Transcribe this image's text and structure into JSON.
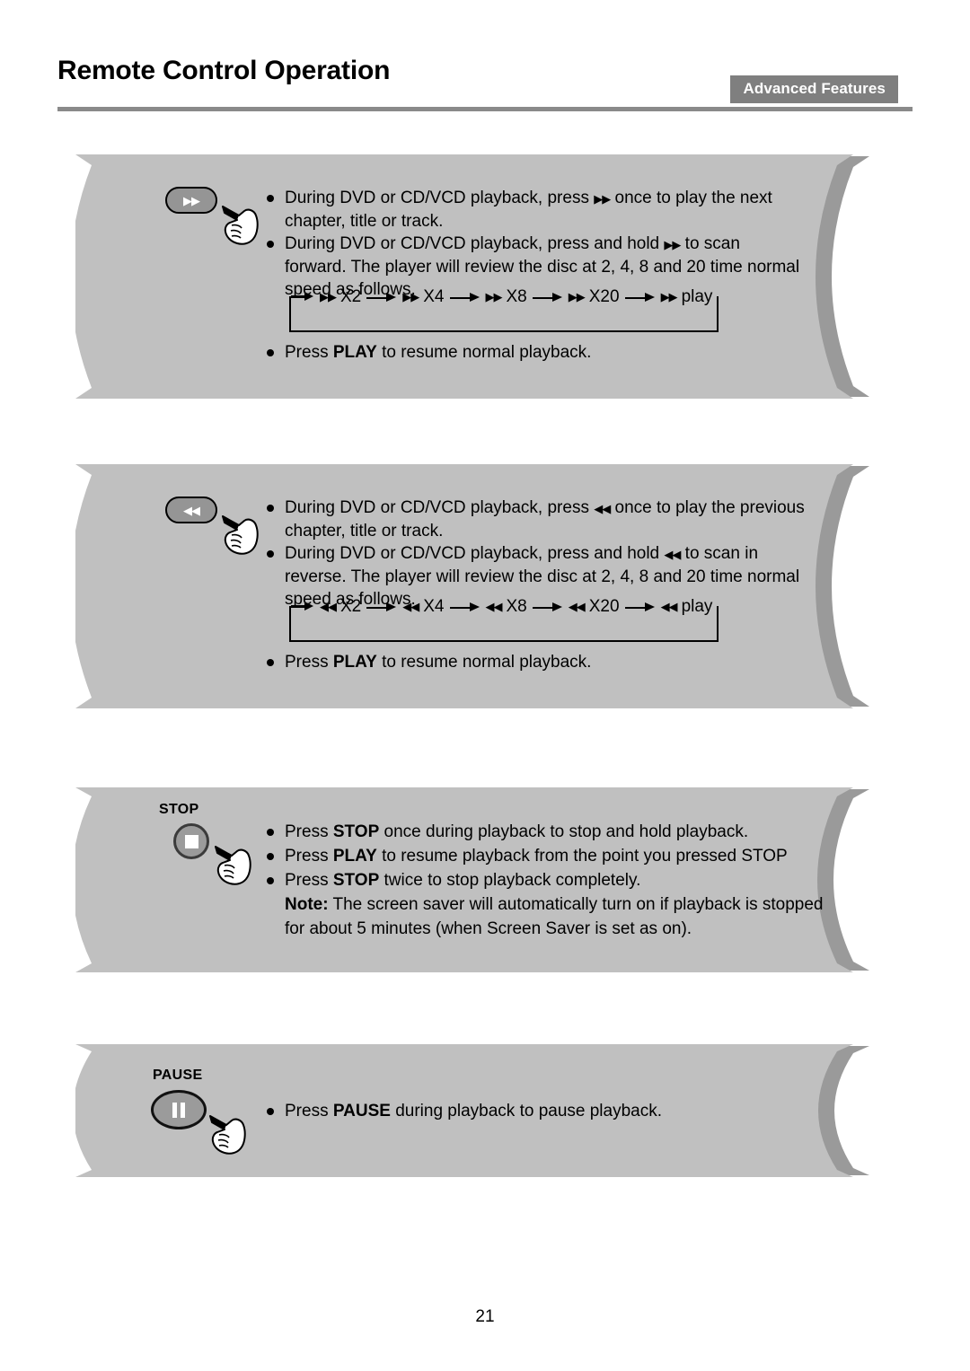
{
  "header": {
    "title": "Remote Control Operation",
    "section_badge": "Advanced Features",
    "badge_color": "#7f7f7f",
    "rule_color": "#8a8a8a"
  },
  "page": {
    "number": "21",
    "background": "#ffffff",
    "banner_fill": "#c0c0c0",
    "banner_shadow": "#9a9a9a"
  },
  "blocks": [
    {
      "id": "fast-forward",
      "button": {
        "icon": "fast-forward-icon",
        "glyph": "▶▶",
        "shape": "pill",
        "caption": ""
      },
      "lines": [
        {
          "bullet": true,
          "parts": [
            {
              "text": "During DVD or CD/VCD playback, press "
            },
            {
              "text": "▶▶",
              "style": "glyph"
            },
            {
              "text": " once to play the next chapter, title or track."
            }
          ]
        },
        {
          "bullet": true,
          "parts": [
            {
              "text": "During DVD or CD/VCD playback, press and hold "
            },
            {
              "text": "▶▶",
              "style": "glyph"
            },
            {
              "text": " to scan forward. The player will review the disc at 2, 4, 8 and 20 time normal speed as follows."
            }
          ]
        }
      ],
      "diagram": {
        "direction_glyph": "▶▶",
        "steps": [
          "X2",
          "X4",
          "X8",
          "X20",
          "play"
        ]
      },
      "footer_lines": [
        {
          "bullet": true,
          "parts": [
            {
              "text": "Press "
            },
            {
              "text": "PLAY",
              "style": "bold"
            },
            {
              "text": " to resume normal playback."
            }
          ]
        }
      ]
    },
    {
      "id": "rewind",
      "button": {
        "icon": "rewind-icon",
        "glyph": "◀◀",
        "shape": "pill",
        "caption": ""
      },
      "lines": [
        {
          "bullet": true,
          "parts": [
            {
              "text": "During DVD or CD/VCD playback, press "
            },
            {
              "text": "◀◀",
              "style": "glyph"
            },
            {
              "text": " once to play the previous chapter, title or track."
            }
          ]
        },
        {
          "bullet": true,
          "parts": [
            {
              "text": "During DVD or CD/VCD playback, press and hold "
            },
            {
              "text": "◀◀",
              "style": "glyph"
            },
            {
              "text": " to scan in reverse. The player will review the disc at 2, 4, 8 and 20 time normal speed as follows."
            }
          ]
        }
      ],
      "diagram": {
        "direction_glyph": "◀◀",
        "steps": [
          "X2",
          "X4",
          "X8",
          "X20",
          "play"
        ]
      },
      "footer_lines": [
        {
          "bullet": true,
          "parts": [
            {
              "text": "Press "
            },
            {
              "text": "PLAY",
              "style": "bold"
            },
            {
              "text": " to resume normal playback."
            }
          ]
        }
      ]
    },
    {
      "id": "stop",
      "button": {
        "icon": "stop-icon",
        "glyph": "■",
        "shape": "circle",
        "caption": "STOP"
      },
      "lines": [
        {
          "bullet": true,
          "parts": [
            {
              "text": "Press "
            },
            {
              "text": "STOP",
              "style": "bold"
            },
            {
              "text": " once during playback to stop and hold playback."
            }
          ]
        },
        {
          "bullet": true,
          "parts": [
            {
              "text": "Press "
            },
            {
              "text": "PLAY",
              "style": "bold"
            },
            {
              "text": " to resume playback from the point you pressed STOP"
            }
          ]
        },
        {
          "bullet": true,
          "parts": [
            {
              "text": "Press "
            },
            {
              "text": "STOP",
              "style": "bold"
            },
            {
              "text": " twice to stop playback completely."
            }
          ]
        },
        {
          "bullet": false,
          "parts": [
            {
              "text": "Note:",
              "style": "bold"
            },
            {
              "text": " The screen saver will automatically turn on if playback is stopped for about 5 minutes (when Screen Saver is set as on)."
            }
          ]
        }
      ]
    },
    {
      "id": "pause",
      "button": {
        "icon": "pause-icon",
        "glyph": "❙❙",
        "shape": "ellipse",
        "caption": "PAUSE"
      },
      "lines": [
        {
          "bullet": true,
          "parts": [
            {
              "text": "Press "
            },
            {
              "text": "PAUSE",
              "style": "bold"
            },
            {
              "text": " during playback to pause playback."
            }
          ]
        }
      ]
    }
  ]
}
